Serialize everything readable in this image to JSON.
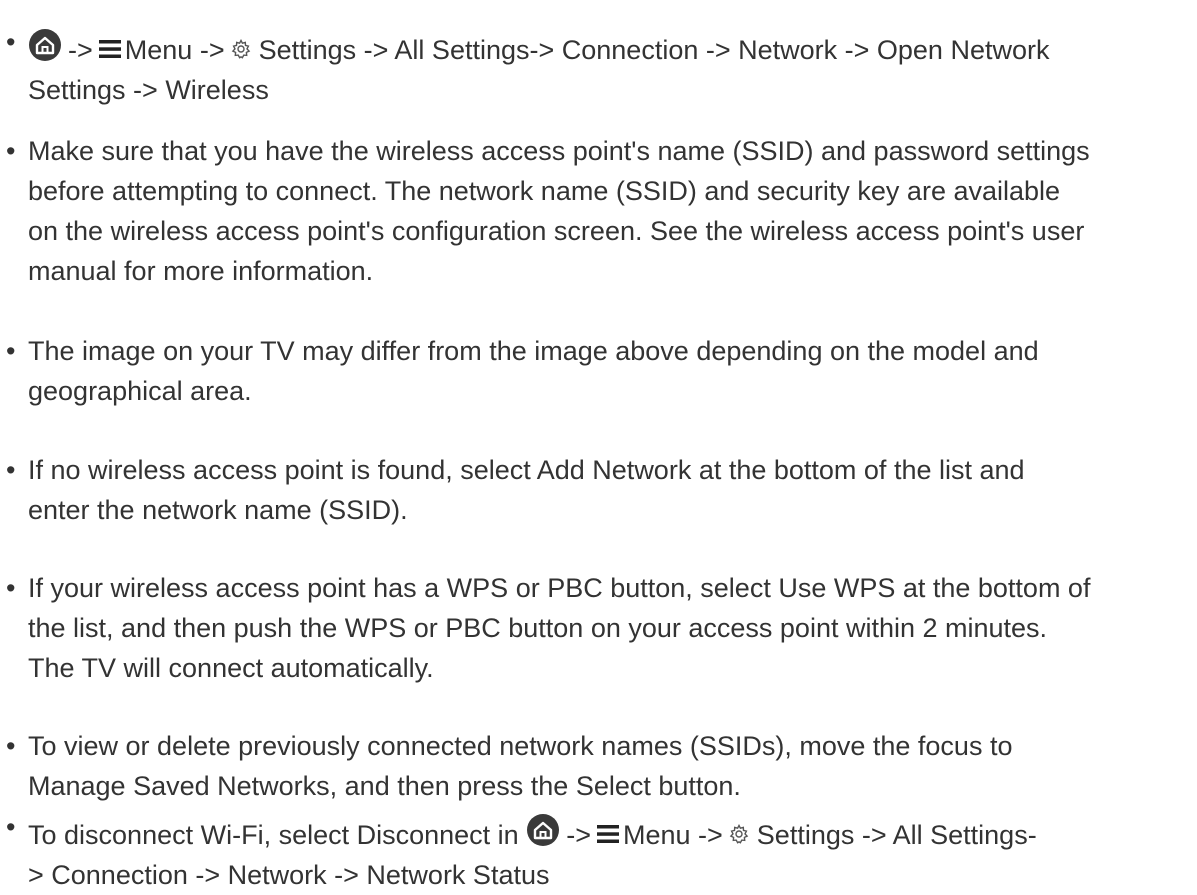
{
  "bullet_char": "•",
  "path_sep": "->",
  "menu_word": "Menu",
  "icons": {
    "home": "home-icon",
    "menu": "hamburger-menu-icon",
    "settings": "gear-icon"
  },
  "colors": {
    "text": "#333333",
    "icon_fill": "#3a3a3a",
    "background": "#ffffff"
  },
  "items": [
    {
      "line1_tail": "Settings -> All Settings-> Connection -> Network -> Open Network",
      "line2": "Settings -> Wireless"
    },
    {
      "lines": [
        "Make sure that you have the wireless access point's name (SSID) and password settings",
        "before attempting to connect. The network name (SSID) and security key are available",
        "on the wireless access point's configuration screen. See the wireless access point's user",
        "manual for more information."
      ]
    },
    {
      "lines": [
        "The image on your TV may differ from the image above depending on the model and",
        "geographical area."
      ]
    },
    {
      "lines": [
        "If no wireless access point is found, select Add Network at the bottom of the list and",
        "enter the network name (SSID)."
      ]
    },
    {
      "lines": [
        "If your wireless access point has a WPS or PBC button, select Use WPS at the bottom of",
        "the list, and then push the WPS or PBC button on your access point within 2 minutes.",
        "The TV will connect automatically."
      ]
    },
    {
      "lines": [
        "To view or delete previously connected network names (SSIDs), move the focus to",
        "Manage Saved Networks, and then press the Select button."
      ]
    },
    {
      "line1_head": "To disconnect Wi-Fi, select Disconnect in",
      "line1_tail": "Settings -> All Settings-",
      "line2": "> Connection -> Network -> Network Status"
    }
  ]
}
